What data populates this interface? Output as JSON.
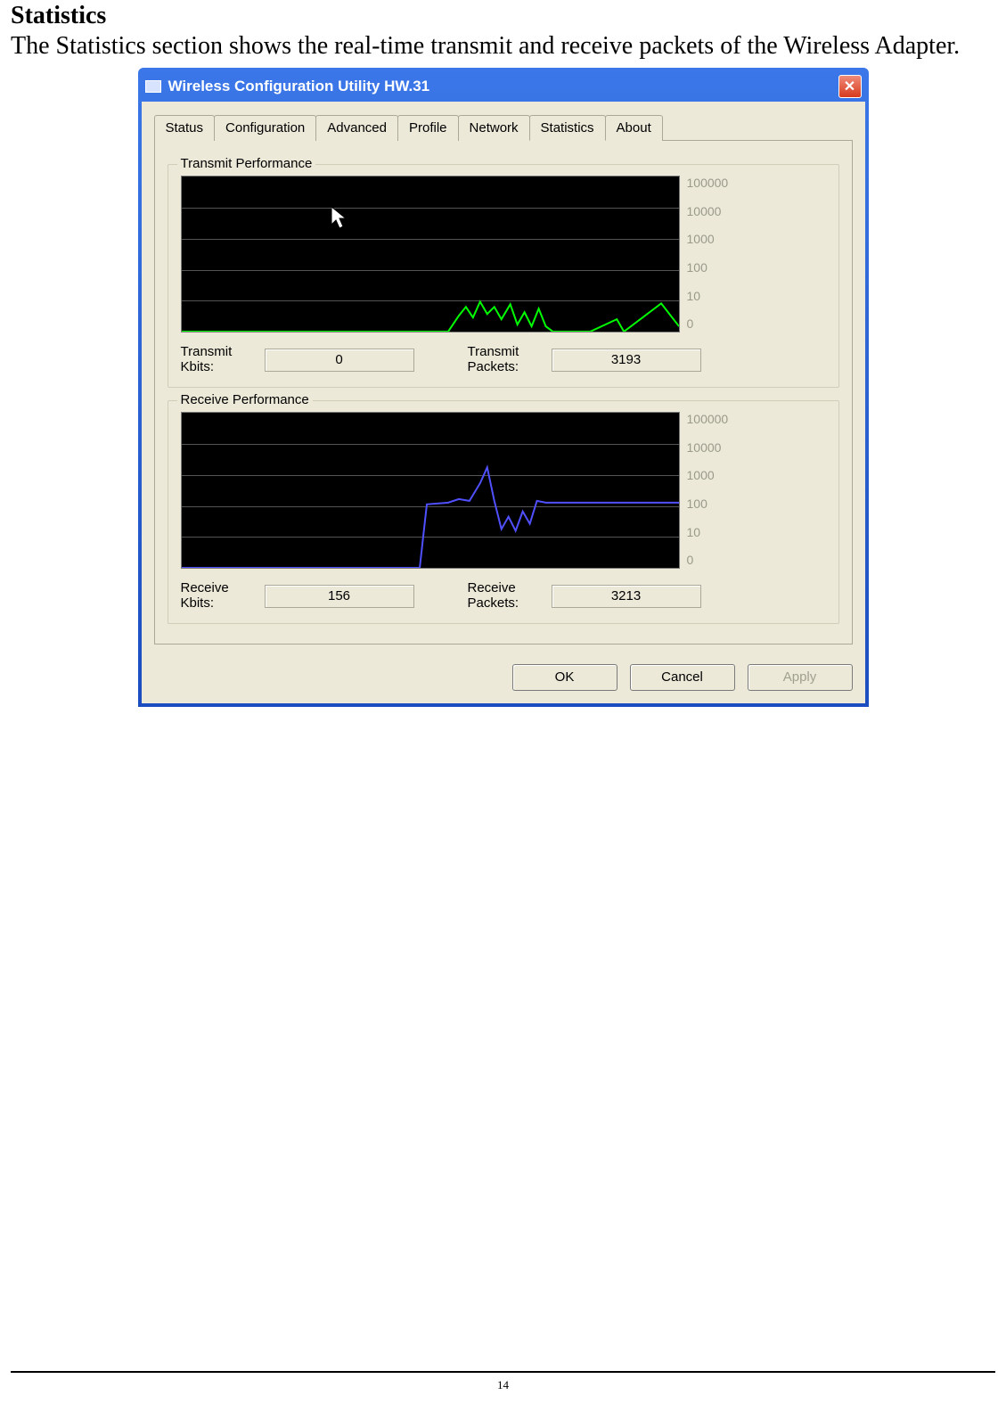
{
  "doc": {
    "heading": "Statistics",
    "paragraph": "The Statistics section shows the real-time transmit and receive packets of the Wireless Adapter."
  },
  "window": {
    "title": "Wireless Configuration Utility HW.31",
    "close_glyph": "✕",
    "tabs": [
      "Status",
      "Configuration",
      "Advanced",
      "Profile",
      "Network",
      "Statistics",
      "About"
    ],
    "active_tab_index": 5,
    "transmit": {
      "group_title": "Transmit Performance",
      "yticks": [
        "100000",
        "10000",
        "1000",
        "100",
        "10",
        "0"
      ],
      "kbits_label": "Transmit\nKbits:",
      "kbits_value": "0",
      "packets_label": "Transmit\nPackets:",
      "packets_value": "3193"
    },
    "receive": {
      "group_title": "Receive Performance",
      "yticks": [
        "100000",
        "10000",
        "1000",
        "100",
        "10",
        "0"
      ],
      "kbits_label": "Receive\nKbits:",
      "kbits_value": "156",
      "packets_label": "Receive\nPackets:",
      "packets_value": "3213"
    },
    "buttons": {
      "ok": "OK",
      "cancel": "Cancel",
      "apply": "Apply"
    }
  },
  "page_number": "14",
  "chart_data": [
    {
      "type": "line",
      "title": "Transmit Performance",
      "xlabel": "",
      "ylabel": "",
      "yscale": "log",
      "ylim": [
        0,
        100000
      ],
      "yticks": [
        0,
        10,
        100,
        1000,
        10000,
        100000
      ],
      "series": [
        {
          "name": "Transmit",
          "color": "#00ff00",
          "note": "values estimated from pixel positions on log-scale graph; x is sample index",
          "x": [
            0,
            10,
            20,
            30,
            40,
            50,
            54,
            56,
            58,
            60,
            62,
            64,
            66,
            68,
            70,
            72,
            74,
            76,
            78,
            80,
            82,
            84,
            86,
            88,
            90,
            92,
            94,
            96,
            98,
            100
          ],
          "values": [
            0,
            0,
            0,
            0,
            0,
            0,
            0,
            3,
            8,
            4,
            12,
            5,
            9,
            3,
            10,
            2,
            6,
            2,
            8,
            2,
            0,
            0,
            0,
            0,
            3,
            0,
            0,
            0,
            10,
            2
          ]
        }
      ]
    },
    {
      "type": "line",
      "title": "Receive Performance",
      "xlabel": "",
      "ylabel": "",
      "yscale": "log",
      "ylim": [
        0,
        100000
      ],
      "yticks": [
        0,
        10,
        100,
        1000,
        10000,
        100000
      ],
      "series": [
        {
          "name": "Receive",
          "color": "#4040ff",
          "note": "values estimated from pixel positions on log-scale graph; x is sample index",
          "x": [
            0,
            10,
            20,
            30,
            40,
            48,
            50,
            52,
            54,
            56,
            58,
            60,
            62,
            64,
            66,
            68,
            70,
            72,
            74,
            76,
            78,
            80,
            82,
            84,
            86,
            88,
            90,
            92,
            94,
            96,
            98,
            100
          ],
          "values": [
            0,
            0,
            0,
            0,
            0,
            0,
            150,
            160,
            150,
            160,
            200,
            700,
            160,
            30,
            60,
            30,
            90,
            40,
            150,
            160,
            160,
            150,
            160,
            150,
            160,
            150,
            160,
            150,
            160,
            160,
            150,
            160
          ]
        }
      ]
    }
  ]
}
